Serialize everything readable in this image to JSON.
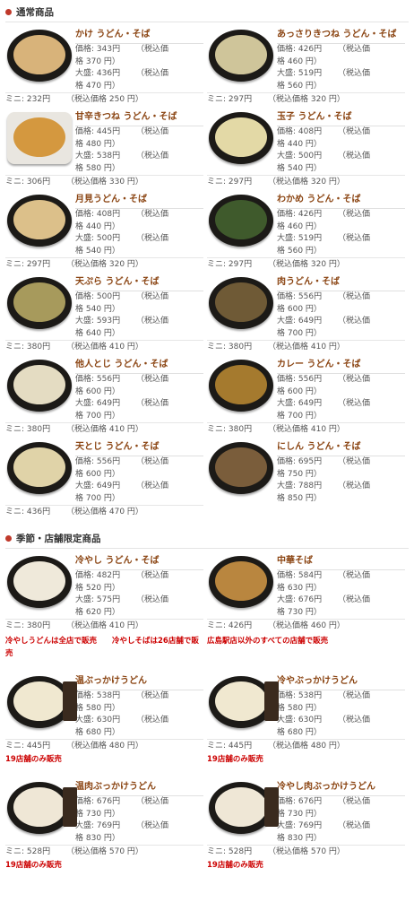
{
  "sections": [
    {
      "title": "通常商品"
    },
    {
      "title": "季節・店舗限定商品"
    }
  ],
  "labels": {
    "price": "価格",
    "large": "大盛",
    "mini": "ミニ",
    "tax": "税込価",
    "tax_cont": "格"
  },
  "regular": [
    {
      "name": "かけ うどん・そば",
      "price": "価格: 343円",
      "price_tax": "（税込価",
      "price_tax2": "格 370 円）",
      "large": "大盛: 436円",
      "large_tax": "（税込価",
      "large_tax2": "格 470 円）",
      "mini": "ミニ: 232円",
      "mini_tax": "（税込価格 250 円）",
      "soup": "#d8b37a"
    },
    {
      "name": "あっさりきつね うどん・そば",
      "price": "価格: 426円",
      "price_tax": "（税込価",
      "price_tax2": "格 460 円）",
      "large": "大盛: 519円",
      "large_tax": "（税込価",
      "large_tax2": "格 560 円）",
      "mini": "ミニ: 297円",
      "mini_tax": "（税込価格 320 円）",
      "soup": "#cfc59a"
    },
    {
      "name": "甘辛きつね うどん・そば",
      "price": "価格: 445円",
      "price_tax": "（税込価",
      "price_tax2": "格 480 円）",
      "large": "大盛: 538円",
      "large_tax": "（税込価",
      "large_tax2": "格 580 円）",
      "mini": "ミニ: 306円",
      "mini_tax": "（税込価格 330 円）",
      "soup": "#d4983f"
    },
    {
      "name": "玉子 うどん・そば",
      "price": "価格: 408円",
      "price_tax": "（税込価",
      "price_tax2": "格 440 円）",
      "large": "大盛: 500円",
      "large_tax": "（税込価",
      "large_tax2": "格 540 円）",
      "mini": "ミニ: 297円",
      "mini_tax": "（税込価格 320 円）",
      "soup": "#e3d9a6"
    },
    {
      "name": "月見うどん・そば",
      "price": "価格: 408円",
      "price_tax": "（税込価",
      "price_tax2": "格 440 円）",
      "large": "大盛: 500円",
      "large_tax": "（税込価",
      "large_tax2": "格 540 円）",
      "mini": "ミニ: 297円",
      "mini_tax": "（税込価格 320 円）",
      "soup": "#dcc08a"
    },
    {
      "name": "わかめ うどん・そば",
      "price": "価格: 426円",
      "price_tax": "（税込価",
      "price_tax2": "格 460 円）",
      "large": "大盛: 519円",
      "large_tax": "（税込価",
      "large_tax2": "格 560 円）",
      "mini": "ミニ: 297円",
      "mini_tax": "（税込価格 320 円）",
      "soup": "#3f5a2c"
    },
    {
      "name": "天ぷら うどん・そば",
      "price": "価格: 500円",
      "price_tax": "（税込価",
      "price_tax2": "格 540 円）",
      "large": "大盛: 593円",
      "large_tax": "（税込価",
      "large_tax2": "格 640 円）",
      "mini": "ミニ: 380円",
      "mini_tax": "（税込価格 410 円）",
      "soup": "#a79a5c"
    },
    {
      "name": "肉うどん・そば",
      "price": "価格: 556円",
      "price_tax": "（税込価",
      "price_tax2": "格 600 円）",
      "large": "大盛: 649円",
      "large_tax": "（税込価",
      "large_tax2": "格 700 円）",
      "mini": "ミニ: 380円",
      "mini_tax": "（税込価格 410 円）",
      "soup": "#6f5a36"
    },
    {
      "name": "他人とじ うどん・そば",
      "price": "価格: 556円",
      "price_tax": "（税込価",
      "price_tax2": "格 600 円）",
      "large": "大盛: 649円",
      "large_tax": "（税込価",
      "large_tax2": "格 700 円）",
      "mini": "ミニ: 380円",
      "mini_tax": "（税込価格 410 円）",
      "soup": "#e4dcc2"
    },
    {
      "name": "カレー うどん・そば",
      "price": "価格: 556円",
      "price_tax": "（税込価",
      "price_tax2": "格 600 円）",
      "large": "大盛: 649円",
      "large_tax": "（税込価",
      "large_tax2": "格 700 円）",
      "mini": "ミニ: 380円",
      "mini_tax": "（税込価格 410 円）",
      "soup": "#a57a2e"
    },
    {
      "name": "天とじ うどん・そば",
      "price": "価格: 556円",
      "price_tax": "（税込価",
      "price_tax2": "格 600 円）",
      "large": "大盛: 649円",
      "large_tax": "（税込価",
      "large_tax2": "格 700 円）",
      "mini": "ミニ: 436円",
      "mini_tax": "（税込価格 470 円）",
      "soup": "#e0d3a8"
    },
    {
      "name": "にしん うどん・そば",
      "price": "価格: 695円",
      "price_tax": "（税込価",
      "price_tax2": "格 750 円）",
      "large": "大盛: 788円",
      "large_tax": "（税込価",
      "large_tax2": "格 850 円）",
      "mini": "",
      "mini_tax": "",
      "soup": "#7a5d3b"
    }
  ],
  "seasonal": [
    {
      "name": "冷やし うどん・そば",
      "price": "価格: 482円",
      "price_tax": "（税込価",
      "price_tax2": "格 520 円）",
      "large": "大盛: 575円",
      "large_tax": "（税込価",
      "large_tax2": "格 620 円）",
      "mini": "ミニ: 380円",
      "mini_tax": "（税込価格 410 円）",
      "note": "冷やしうどんは全店で販売　　冷やしそばは26店舗で販売",
      "soup": "#efe9da"
    },
    {
      "name": "中華そば",
      "price": "価格: 584円",
      "price_tax": "（税込価",
      "price_tax2": "格 630 円）",
      "large": "大盛: 676円",
      "large_tax": "（税込価",
      "large_tax2": "格 730 円）",
      "mini": "ミニ: 426円",
      "mini_tax": "（税込価格 460 円）",
      "note": "広島駅店以外のすべての店舗で販売",
      "soup": "#b9863f"
    },
    {
      "name": "温ぶっかけうどん",
      "price": "価格: 538円",
      "price_tax": "（税込価",
      "price_tax2": "格 580 円）",
      "large": "大盛: 630円",
      "large_tax": "（税込価",
      "large_tax2": "格 680 円）",
      "mini": "ミニ: 445円",
      "mini_tax": "（税込価格 480 円）",
      "note": "19店舗のみ販売",
      "soup": "#f0e8d0"
    },
    {
      "name": "冷やぶっかけうどん",
      "price": "価格: 538円",
      "price_tax": "（税込価",
      "price_tax2": "格 580 円）",
      "large": "大盛: 630円",
      "large_tax": "（税込価",
      "large_tax2": "格 680 円）",
      "mini": "ミニ: 445円",
      "mini_tax": "（税込価格 480 円）",
      "note": "19店舗のみ販売",
      "soup": "#f0e8d0"
    },
    {
      "name": "温肉ぶっかけうどん",
      "price": "価格: 676円",
      "price_tax": "（税込価",
      "price_tax2": "格 730 円）",
      "large": "大盛: 769円",
      "large_tax": "（税込価",
      "large_tax2": "格 830 円）",
      "mini": "ミニ: 528円",
      "mini_tax": "（税込価格 570 円）",
      "note": "19店舗のみ販売",
      "soup": "#efe7d6"
    },
    {
      "name": "冷やし肉ぶっかけうどん",
      "price": "価格: 676円",
      "price_tax": "（税込価",
      "price_tax2": "格 730 円）",
      "large": "大盛: 769円",
      "large_tax": "（税込価",
      "large_tax2": "格 830 円）",
      "mini": "ミニ: 528円",
      "mini_tax": "（税込価格 570 円）",
      "note": "19店舗のみ販売",
      "soup": "#efe7d6"
    }
  ]
}
